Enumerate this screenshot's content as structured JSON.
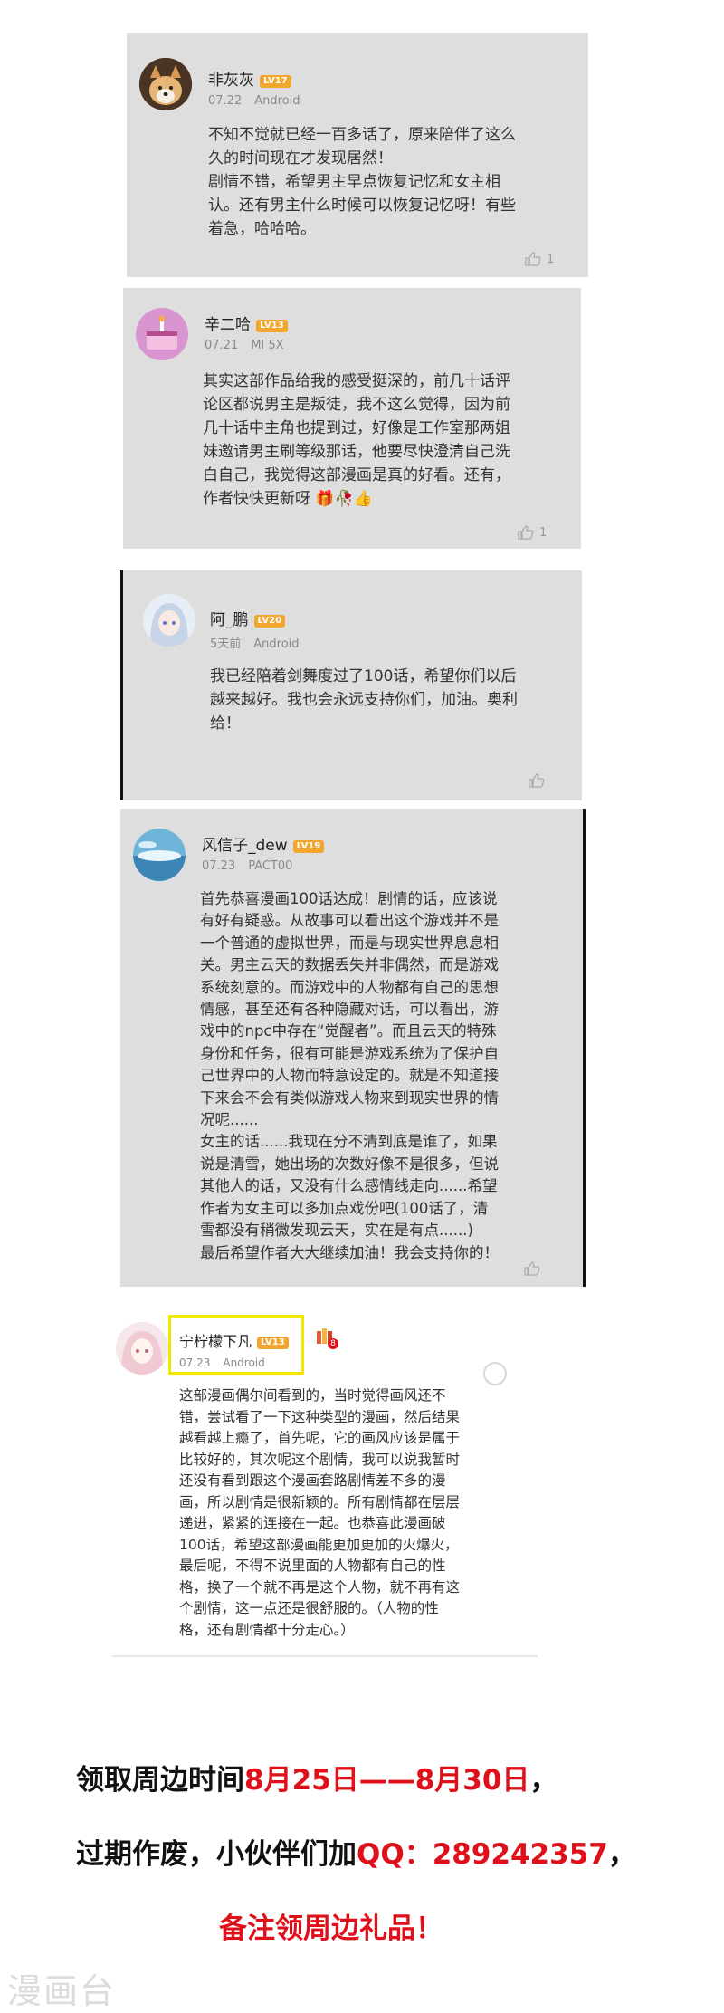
{
  "comments": [
    {
      "username": "非灰灰",
      "level": "LV17",
      "date": "07.22",
      "device": "Android",
      "text": "不知不觉就已经一百多话了，原来陪伴了这么\n久的时间现在才发现居然！\n剧情不错，希望男主早点恢复记忆和女主相\n认。还有男主什么时候可以恢复记忆呀！有些\n着急，哈哈哈。",
      "likes": "1"
    },
    {
      "username": "辛二哈",
      "level": "LV13",
      "date": "07.21",
      "device": "MI 5X",
      "text": "其实这部作品给我的感受挺深的，前几十话评\n论区都说男主是叛徒，我不这么觉得，因为前\n几十话中主角也提到过，好像是工作室那两姐\n妹邀请男主刷等级那话，他要尽快澄清自己洗\n白自己，我觉得这部漫画是真的好看。还有，\n作者快快更新呀",
      "likes": "1"
    },
    {
      "username": "阿_鹏",
      "level": "LV20",
      "date": "5天前",
      "device": "Android",
      "text": "我已经陪着剑舞度过了100话，希望你们以后\n越来越好。我也会永远支持你们，加油。奥利\n给！",
      "likes": ""
    },
    {
      "username": "风信子_dew",
      "level": "LV19",
      "date": "07.23",
      "device": "PACT00",
      "text": "首先恭喜漫画100话达成！剧情的话，应该说\n有好有疑惑。从故事可以看出这个游戏并不是\n一个普通的虚拟世界，而是与现实世界息息相\n关。男主云天的数据丢失并非偶然，而是游戏\n系统刻意的。而游戏中的人物都有自己的思想\n情感，甚至还有各种隐藏对话，可以看出，游\n戏中的npc中存在“觉醒者”。而且云天的特殊\n身份和任务，很有可能是游戏系统为了保护自\n己世界中的人物而特意设定的。就是不知道接\n下来会不会有类似游戏人物来到现实世界的情\n况呢......\n女主的话......我现在分不清到底是谁了，如果\n说是清雪，她出场的次数好像不是很多，但说\n其他人的话，又没有什么感情线走向......希望\n作者为女主可以多加点戏份吧(100话了，清\n雪都没有稍微发现云天，实在是有点......)\n最后希望作者大大继续加油！我会支持你的！",
      "likes": ""
    },
    {
      "username": "宁柠檬下凡",
      "level": "LV13",
      "date": "07.23",
      "device": "Android",
      "text": "这部漫画偶尔间看到的，当时觉得画风还不\n错，尝试看了一下这种类型的漫画，然后结果\n越看越上瘾了，首先呢，它的画风应该是属于\n比较好的，其次呢这个剧情，我可以说我暂时\n还没有看到跟这个漫画套路剧情差不多的漫\n画，所以剧情是很新颖的。所有剧情都在层层\n递进，紧紧的连接在一起。也恭喜此漫画破\n100话，希望这部漫画能更加更加的火爆火，\n最后呢，不得不说里面的人物都有自己的性\n格，换了一个就不再是这个人物，就不再有这\n个剧情，这一点还是很舒服的。（人物的性\n格，还有剧情都十分走心。）",
      "badge_count": "8"
    }
  ],
  "promo": {
    "line1_black": "领取周边时间",
    "line1_red": "8月25日——8月30日",
    "line1_end": "，",
    "line2_black": "过期作废，小伙伴们加",
    "line2_red": "QQ：289242357",
    "line2_end": "，",
    "line3_red": "备注领周边礼品！"
  },
  "watermark": "漫画台",
  "colors": {
    "card_gray": "#dedede",
    "level_badge": "#f3a62d",
    "highlight_box": "#f2e600",
    "promo_red": "#e0101a"
  }
}
